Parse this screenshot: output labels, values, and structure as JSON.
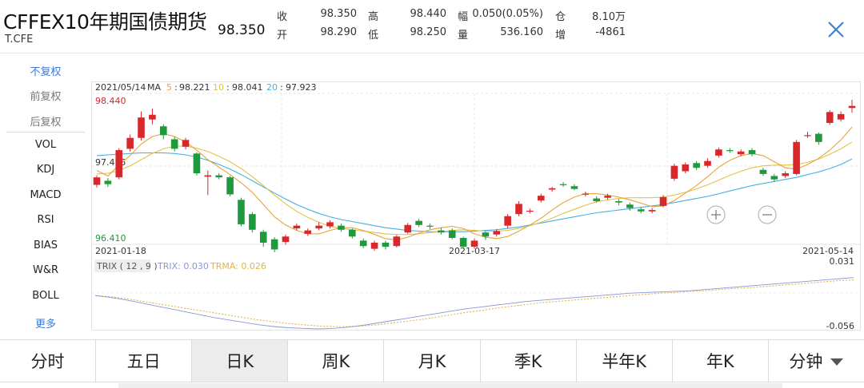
{
  "header": {
    "title": "CFFEX10年期国债期货",
    "code": "T.CFE",
    "price": "98.350",
    "quotes": [
      {
        "label": "收",
        "value": "98.350"
      },
      {
        "label": "高",
        "value": "98.440"
      },
      {
        "label": "幅",
        "value": "0.050(0.05%)"
      },
      {
        "label": "仓",
        "value": "8.10万"
      },
      {
        "label": "开",
        "value": "98.290"
      },
      {
        "label": "低",
        "value": "98.250"
      },
      {
        "label": "量",
        "value": "536.160"
      },
      {
        "label": "增",
        "value": "-4861"
      }
    ]
  },
  "menu": [
    {
      "label": "不复权",
      "active": true
    },
    {
      "label": "前复权",
      "active": false
    },
    {
      "label": "后复权",
      "active": false
    },
    {
      "label": "VOL"
    },
    {
      "label": "KDJ"
    },
    {
      "label": "MACD"
    },
    {
      "label": "RSI"
    },
    {
      "label": "BIAS"
    },
    {
      "label": "W&R"
    },
    {
      "label": "BOLL"
    },
    {
      "label": "更多",
      "link": true
    }
  ],
  "ma_legend": {
    "date": "2021/05/14",
    "label": "MA",
    "items": [
      {
        "period": "5",
        "value": "98.221"
      },
      {
        "period": "10",
        "value": "98.041"
      },
      {
        "period": "20",
        "value": "97.923"
      }
    ]
  },
  "axis": {
    "y_top": "98.440",
    "y_mid": "97.425",
    "y_bottom": "96.410",
    "dates": [
      "2021-01-18",
      "2021-03-17",
      "2021-05-14"
    ]
  },
  "trix": {
    "label": "TRIX ( 12 , 9 )",
    "trix_label": "TRIX: 0.030",
    "trma_label": "TRMA: 0.026",
    "y_max": "0.031",
    "y_min": "-0.056"
  },
  "tabs": [
    {
      "label": "分时"
    },
    {
      "label": "五日"
    },
    {
      "label": "日K",
      "active": true
    },
    {
      "label": "周K"
    },
    {
      "label": "月K"
    },
    {
      "label": "季K"
    },
    {
      "label": "半年K"
    },
    {
      "label": "年K"
    },
    {
      "label": "分钟",
      "dropdown": true
    }
  ],
  "colors": {
    "up": "#d8282c",
    "down": "#1e9a3c",
    "ma5": "#e8a33c",
    "ma10": "#e3c24a",
    "ma20": "#46b0e3",
    "trix": "#8a96d8",
    "trma": "#e0b44a",
    "link": "#3a7bd5"
  },
  "chart_data": {
    "type": "candlestick",
    "x_range": [
      "2021-01-18",
      "2021-05-14"
    ],
    "ylim": [
      96.41,
      98.44
    ],
    "candles": [
      [
        97.19,
        97.3,
        97.33,
        97.15
      ],
      [
        97.25,
        97.2,
        97.29,
        97.16
      ],
      [
        97.3,
        97.7,
        97.73,
        97.27
      ],
      [
        97.72,
        97.88,
        97.93,
        97.68
      ],
      [
        97.88,
        98.18,
        98.27,
        97.84
      ],
      [
        98.15,
        98.22,
        98.31,
        98.08
      ],
      [
        98.05,
        97.92,
        98.08,
        97.86
      ],
      [
        97.86,
        97.72,
        97.9,
        97.68
      ],
      [
        97.75,
        97.85,
        97.88,
        97.71
      ],
      [
        97.65,
        97.36,
        97.67,
        97.33
      ],
      [
        97.31,
        97.33,
        97.4,
        97.04
      ],
      [
        97.33,
        97.3,
        97.36,
        97.27
      ],
      [
        97.3,
        97.05,
        97.32,
        97.02
      ],
      [
        96.97,
        96.61,
        97.0,
        96.58
      ],
      [
        96.76,
        96.53,
        96.79,
        96.49
      ],
      [
        96.5,
        96.34,
        96.53,
        96.28
      ],
      [
        96.39,
        96.24,
        96.42,
        96.2
      ],
      [
        96.35,
        96.43,
        96.46,
        96.31
      ],
      [
        96.55,
        96.59,
        96.62,
        96.52
      ],
      [
        96.47,
        96.52,
        96.55,
        96.44
      ],
      [
        96.55,
        96.59,
        96.64,
        96.52
      ],
      [
        96.58,
        96.64,
        96.67,
        96.55
      ],
      [
        96.59,
        96.53,
        96.62,
        96.5
      ],
      [
        96.53,
        96.43,
        96.55,
        96.4
      ],
      [
        96.37,
        96.29,
        96.4,
        96.26
      ],
      [
        96.25,
        96.34,
        96.37,
        96.22
      ],
      [
        96.34,
        96.28,
        96.37,
        96.24
      ],
      [
        96.29,
        96.43,
        96.45,
        96.27
      ],
      [
        96.49,
        96.6,
        96.63,
        96.47
      ],
      [
        96.66,
        96.6,
        96.69,
        96.57
      ],
      [
        96.59,
        96.58,
        96.62,
        96.54
      ],
      [
        96.52,
        96.49,
        96.56,
        96.46
      ],
      [
        96.52,
        96.41,
        96.55,
        96.39
      ],
      [
        96.41,
        96.28,
        96.43,
        96.25
      ],
      [
        96.28,
        96.37,
        96.4,
        96.25
      ],
      [
        96.49,
        96.43,
        96.51,
        96.38
      ],
      [
        96.46,
        96.51,
        96.54,
        96.43
      ],
      [
        96.59,
        96.73,
        96.76,
        96.55
      ],
      [
        96.76,
        96.91,
        96.95,
        96.73
      ],
      [
        96.81,
        96.81,
        96.84,
        96.77
      ],
      [
        96.96,
        97.03,
        97.06,
        96.93
      ],
      [
        97.12,
        97.14,
        97.16,
        97.09
      ],
      [
        97.2,
        97.19,
        97.23,
        97.16
      ],
      [
        97.17,
        97.13,
        97.2,
        97.11
      ],
      [
        97.05,
        97.06,
        97.09,
        97.02
      ],
      [
        96.99,
        96.95,
        97.02,
        96.93
      ],
      [
        97.0,
        97.03,
        97.06,
        96.97
      ],
      [
        96.95,
        96.93,
        96.98,
        96.89
      ],
      [
        96.9,
        96.85,
        96.93,
        96.81
      ],
      [
        96.83,
        96.8,
        96.86,
        96.77
      ],
      [
        96.8,
        96.82,
        96.85,
        96.77
      ],
      [
        96.88,
        97.01,
        97.04,
        96.86
      ],
      [
        97.28,
        97.47,
        97.5,
        97.25
      ],
      [
        97.39,
        97.49,
        97.52,
        97.36
      ],
      [
        97.51,
        97.44,
        97.54,
        97.41
      ],
      [
        97.47,
        97.54,
        97.58,
        97.44
      ],
      [
        97.62,
        97.71,
        97.74,
        97.59
      ],
      [
        97.7,
        97.69,
        97.73,
        97.66
      ],
      [
        97.64,
        97.68,
        97.71,
        97.61
      ],
      [
        97.7,
        97.64,
        97.73,
        97.61
      ],
      [
        97.41,
        97.35,
        97.44,
        97.32
      ],
      [
        97.32,
        97.27,
        97.35,
        97.24
      ],
      [
        97.32,
        97.36,
        97.39,
        97.29
      ],
      [
        97.35,
        97.82,
        97.85,
        97.33
      ],
      [
        97.91,
        97.92,
        97.97,
        97.88
      ],
      [
        97.94,
        97.82,
        97.96,
        97.78
      ],
      [
        98.1,
        98.26,
        98.29,
        98.07
      ],
      [
        98.15,
        98.23,
        98.27,
        98.12
      ],
      [
        98.32,
        98.35,
        98.44,
        98.25
      ]
    ],
    "ma5": [
      97.4,
      97.32,
      97.48,
      97.62,
      97.79,
      97.9,
      97.94,
      97.9,
      97.82,
      97.7,
      97.56,
      97.45,
      97.34,
      97.22,
      97.08,
      96.9,
      96.72,
      96.6,
      96.52,
      96.47,
      96.47,
      96.52,
      96.56,
      96.56,
      96.52,
      96.46,
      96.4,
      96.38,
      96.42,
      96.48,
      96.53,
      96.56,
      96.58,
      96.55,
      96.47,
      96.42,
      96.4,
      96.43,
      96.51,
      96.6,
      96.7,
      96.82,
      96.93,
      97.01,
      97.06,
      97.06,
      97.04,
      97.01,
      96.97,
      96.92,
      96.87,
      96.88,
      96.96,
      97.07,
      97.18,
      97.31,
      97.45,
      97.55,
      97.62,
      97.65,
      97.62,
      97.53,
      97.44,
      97.42,
      97.49,
      97.58,
      97.7,
      97.85,
      98.04
    ],
    "ma10": [
      97.35,
      97.36,
      97.4,
      97.47,
      97.56,
      97.65,
      97.72,
      97.76,
      97.76,
      97.73,
      97.68,
      97.61,
      97.53,
      97.43,
      97.31,
      97.18,
      97.04,
      96.91,
      96.8,
      96.71,
      96.64,
      96.58,
      96.55,
      96.53,
      96.51,
      96.49,
      96.47,
      96.46,
      96.46,
      96.47,
      96.49,
      96.5,
      96.52,
      96.53,
      96.52,
      96.51,
      96.51,
      96.52,
      96.55,
      96.59,
      96.64,
      96.7,
      96.77,
      96.83,
      96.89,
      96.94,
      96.97,
      96.99,
      97.0,
      97.0,
      97.0,
      97.01,
      97.04,
      97.08,
      97.13,
      97.19,
      97.26,
      97.33,
      97.39,
      97.44,
      97.47,
      97.48,
      97.48,
      97.49,
      97.52,
      97.57,
      97.64,
      97.72,
      97.82
    ],
    "ma20": [
      97.62,
      97.63,
      97.64,
      97.65,
      97.66,
      97.66,
      97.66,
      97.65,
      97.63,
      97.6,
      97.55,
      97.49,
      97.42,
      97.34,
      97.25,
      97.16,
      97.07,
      96.98,
      96.9,
      96.83,
      96.77,
      96.72,
      96.68,
      96.65,
      96.62,
      96.59,
      96.56,
      96.54,
      96.52,
      96.51,
      96.5,
      96.5,
      96.5,
      96.5,
      96.51,
      96.52,
      96.53,
      96.55,
      96.57,
      96.6,
      96.63,
      96.66,
      96.69,
      96.72,
      96.75,
      96.78,
      96.8,
      96.82,
      96.84,
      96.86,
      96.88,
      96.9,
      96.93,
      96.96,
      96.99,
      97.02,
      97.06,
      97.1,
      97.14,
      97.18,
      97.21,
      97.24,
      97.27,
      97.3,
      97.34,
      97.38,
      97.43,
      97.49,
      97.57
    ],
    "trix_series": {
      "ylim": [
        -0.056,
        0.031
      ],
      "trix": [
        0.0,
        -0.003,
        -0.007,
        -0.012,
        -0.017,
        -0.022,
        -0.027,
        -0.032,
        -0.037,
        -0.041,
        -0.045,
        -0.049,
        -0.052,
        -0.054,
        -0.055,
        -0.056,
        -0.055,
        -0.053,
        -0.05,
        -0.046,
        -0.042,
        -0.038,
        -0.034,
        -0.03,
        -0.026,
        -0.022,
        -0.019,
        -0.016,
        -0.013,
        -0.01,
        -0.008,
        -0.006,
        -0.004,
        -0.002,
        0.0,
        0.002,
        0.004,
        0.005,
        0.006,
        0.007,
        0.008,
        0.01,
        0.012,
        0.014,
        0.016,
        0.018,
        0.02,
        0.022,
        0.024,
        0.026,
        0.028,
        0.03
      ],
      "trma": [
        0.0,
        -0.002,
        -0.005,
        -0.009,
        -0.013,
        -0.017,
        -0.021,
        -0.025,
        -0.029,
        -0.033,
        -0.037,
        -0.041,
        -0.044,
        -0.047,
        -0.049,
        -0.051,
        -0.052,
        -0.052,
        -0.051,
        -0.049,
        -0.046,
        -0.043,
        -0.04,
        -0.036,
        -0.032,
        -0.028,
        -0.025,
        -0.021,
        -0.018,
        -0.015,
        -0.012,
        -0.01,
        -0.008,
        -0.006,
        -0.004,
        -0.002,
        0.0,
        0.002,
        0.004,
        0.005,
        0.007,
        0.008,
        0.01,
        0.012,
        0.013,
        0.015,
        0.017,
        0.019,
        0.021,
        0.023,
        0.025,
        0.026
      ]
    }
  }
}
